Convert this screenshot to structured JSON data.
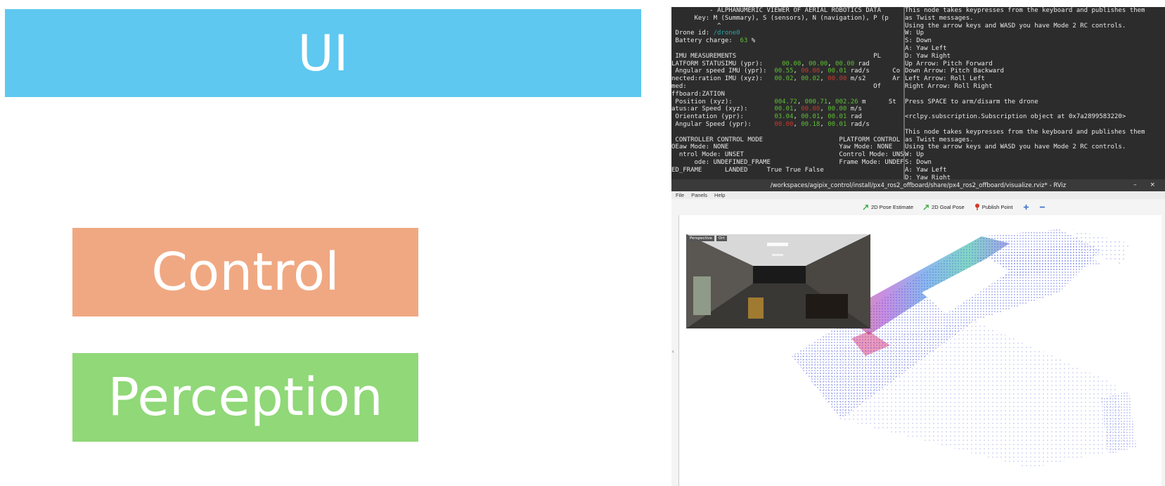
{
  "blocks": {
    "ui": "UI",
    "control": "Control",
    "perception": "Perception"
  },
  "colors": {
    "ui": "#5ec8f0",
    "control": "#f0a882",
    "perception": "#90d878",
    "terminal_bg": "#2c2c2c",
    "value_green": "#5fbf36",
    "value_red": "#c33a2e",
    "value_cyan": "#2aa6a6"
  },
  "terminal_left": {
    "lines": [
      [
        {
          "t": "          - ALPHANUMERIC VIEWER OF AERIAL ROBOTICS DATA"
        }
      ],
      [
        {
          "t": "      Key: M (Summary), S (sensors), N (navigation), P (p"
        }
      ],
      [
        {
          "t": "            ^"
        }
      ],
      [
        {
          "t": " Drone id: "
        },
        {
          "t": "/drone0",
          "k": "c"
        }
      ],
      [
        {
          "t": " Battery charge:  "
        },
        {
          "t": "63",
          "k": "g"
        },
        {
          "t": " %"
        }
      ],
      [
        {
          "t": ""
        }
      ],
      [
        {
          "t": " IMU MEASUREMENTS                                    PL"
        }
      ],
      [
        {
          "t": "LATFORM STATUSIMU (ypr):     "
        },
        {
          "t": "00.00",
          "k": "g"
        },
        {
          "t": ", "
        },
        {
          "t": "00.00",
          "k": "g"
        },
        {
          "t": ", "
        },
        {
          "t": "00.00",
          "k": "g"
        },
        {
          "t": " rad"
        }
      ],
      [
        {
          "t": " Angular speed IMU (ypr):  "
        },
        {
          "t": "00.55",
          "k": "g"
        },
        {
          "t": ", "
        },
        {
          "t": "00.00",
          "k": "r"
        },
        {
          "t": ", "
        },
        {
          "t": "00.01",
          "k": "g"
        },
        {
          "t": " rad/s      Co"
        }
      ],
      [
        {
          "t": "nected:ration IMU (xyz):   "
        },
        {
          "t": "00.02",
          "k": "g"
        },
        {
          "t": ", "
        },
        {
          "t": "00.02",
          "k": "g"
        },
        {
          "t": ", "
        },
        {
          "t": "00.00",
          "k": "r"
        },
        {
          "t": " m/s2       Ar"
        }
      ],
      [
        {
          "t": "med:                                                 Of"
        }
      ],
      [
        {
          "t": "ffboard:ZATION"
        }
      ],
      [
        {
          "t": " Position (xyz):           "
        },
        {
          "t": "004.72",
          "k": "g"
        },
        {
          "t": ", "
        },
        {
          "t": "000.71",
          "k": "g"
        },
        {
          "t": ", "
        },
        {
          "t": "002.26",
          "k": "g"
        },
        {
          "t": " m      St"
        }
      ],
      [
        {
          "t": "atus:ar Speed (xyz):       "
        },
        {
          "t": "00.01",
          "k": "g"
        },
        {
          "t": ", "
        },
        {
          "t": "00.00",
          "k": "r"
        },
        {
          "t": ", "
        },
        {
          "t": "00.00",
          "k": "g"
        },
        {
          "t": " m/s"
        }
      ],
      [
        {
          "t": " Orientation (ypr):        "
        },
        {
          "t": "03.04",
          "k": "g"
        },
        {
          "t": ", "
        },
        {
          "t": "00.01",
          "k": "g"
        },
        {
          "t": ", "
        },
        {
          "t": "00.01",
          "k": "g"
        },
        {
          "t": " rad"
        }
      ],
      [
        {
          "t": " Angular Speed (ypr):      "
        },
        {
          "t": "00.00",
          "k": "r"
        },
        {
          "t": ", "
        },
        {
          "t": "00.18",
          "k": "g"
        },
        {
          "t": ", "
        },
        {
          "t": "00.01",
          "k": "g"
        },
        {
          "t": " rad/s"
        }
      ],
      [
        {
          "t": ""
        }
      ],
      [
        {
          "t": " CONTROLLER CONTROL MODE                    PLATFORM CONTROL MO"
        }
      ],
      [
        {
          "t": "OEaw Mode: NONE                             Yaw Mode: NONE"
        }
      ],
      [
        {
          "t": "  ntrol Mode: UNSET                         Control Mode: UNSET"
        }
      ],
      [
        {
          "t": "      ode: UNDEFINED_FRAME                  Frame Mode: UNDEFIN"
        }
      ],
      [
        {
          "t": "ED_FRAME      LANDED     True True False"
        }
      ]
    ]
  },
  "terminal_right": {
    "lines": [
      "This node takes keypresses from the keyboard and publishes them",
      "as Twist messages.",
      "Using the arrow keys and WASD you have Mode 2 RC controls.",
      "W: Up",
      "S: Down",
      "A: Yaw Left",
      "D: Yaw Right",
      "Up Arrow: Pitch Forward",
      "Down Arrow: Pitch Backward",
      "Left Arrow: Roll Left",
      "Right Arrow: Roll Right",
      "",
      "Press SPACE to arm/disarm the drone",
      "",
      "<rclpy.subscription.Subscription object at 0x7a2899583220>",
      "",
      "This node takes keypresses from the keyboard and publishes them",
      "as Twist messages.",
      "Using the arrow keys and WASD you have Mode 2 RC controls.",
      "W: Up",
      "S: Down",
      "A: Yaw Left",
      "D: Yaw Right"
    ]
  },
  "rviz": {
    "title": "/workspaces/agipix_control/install/px4_ros2_offboard/share/px4_ros2_offboard/visualize.rviz* - RViz",
    "window_buttons": "– ×",
    "menu": [
      "File",
      "Panels",
      "Help"
    ],
    "camera_tabs": [
      "Perspective",
      "Ort"
    ],
    "tools": [
      {
        "label": "2D Pose Estimate",
        "icon": "green-arrow-icon"
      },
      {
        "label": "2D Goal Pose",
        "icon": "green-arrow-icon"
      },
      {
        "label": "Publish Point",
        "icon": "red-pin-icon"
      },
      {
        "label": "",
        "icon": "plus-icon"
      },
      {
        "label": "",
        "icon": "minus-icon"
      }
    ]
  }
}
